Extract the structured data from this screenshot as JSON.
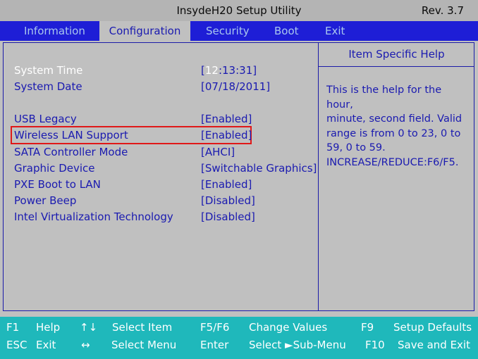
{
  "title_bar": {
    "title": "InsydeH20 Setup Utility",
    "revision": "Rev. 3.7"
  },
  "menu": {
    "tabs": [
      {
        "label": "Information"
      },
      {
        "label": "Configuration"
      },
      {
        "label": "Security"
      },
      {
        "label": "Boot"
      },
      {
        "label": "Exit"
      }
    ],
    "active": "Configuration"
  },
  "settings": {
    "system_time": {
      "label": "System Time",
      "open_bracket": "[",
      "hour": "12",
      "rest": ":13:31]"
    },
    "system_date": {
      "label": "System Date",
      "value": "[07/18/2011]"
    },
    "rows": [
      {
        "label": "USB Legacy",
        "value": "[Enabled]"
      },
      {
        "label": "Wireless LAN Support",
        "value": "[Enabled]"
      },
      {
        "label": "SATA Controller Mode",
        "value": "[AHCI]"
      },
      {
        "label": "Graphic Device",
        "value": "[Switchable Graphics]"
      },
      {
        "label": "PXE Boot to LAN",
        "value": "[Enabled]"
      },
      {
        "label": "Power Beep",
        "value": "[Disabled]"
      },
      {
        "label": "Intel Virtualization Technology",
        "value": "[Disabled]"
      }
    ]
  },
  "help": {
    "title": "Item Specific Help",
    "lines": [
      "This is the help for the hour,",
      "minute, second field. Valid",
      "range is from 0 to 23, 0 to",
      "59, 0 to 59.",
      "INCREASE/REDUCE:F6/F5."
    ]
  },
  "status_bar": {
    "row1": [
      {
        "key": "F1",
        "action": "Help"
      },
      {
        "key": "↑↓",
        "action": "Select Item"
      },
      {
        "key": "F5/F6",
        "action": "Change Values"
      },
      {
        "key": "F9",
        "action": "Setup Defaults"
      }
    ],
    "row2": [
      {
        "key": "ESC",
        "action": "Exit"
      },
      {
        "key": "↔",
        "action": "Select Menu"
      },
      {
        "key": "Enter",
        "action": "Select ►Sub-Menu"
      },
      {
        "key": "F10",
        "action": "Save and Exit"
      }
    ]
  },
  "colors": {
    "background": "#c0c0c0",
    "menu_bar": "#1e1ed6",
    "text_blue": "#1a1ab0",
    "highlight_white": "#ffffff",
    "status_bar": "#1fb8bb",
    "annotation_red": "#e01818"
  }
}
